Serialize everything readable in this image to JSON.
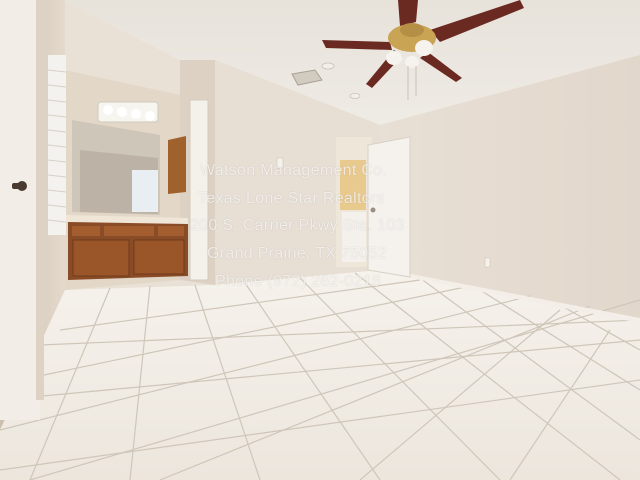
{
  "photo": {
    "subject": "empty-room-with-tile-floor-and-bathroom-vanity"
  },
  "watermark": {
    "line1": "Watson Management Co.",
    "line2": "Texas Lone Star Realtors",
    "line3": "200 S. Carrier Pkwy Ste. 103",
    "line4": "Grand Prairie, TX 75052",
    "line5": "Phone (972) 262-0218"
  },
  "colors": {
    "wall": "#e6ddd2",
    "ceiling": "#ece8e1",
    "floor_tile": "#f1ede6",
    "grout": "#c9c0b4",
    "cabinet_wood": "#8a4c26",
    "fan_blade": "#6a2a22",
    "fan_brass": "#c9a455"
  }
}
